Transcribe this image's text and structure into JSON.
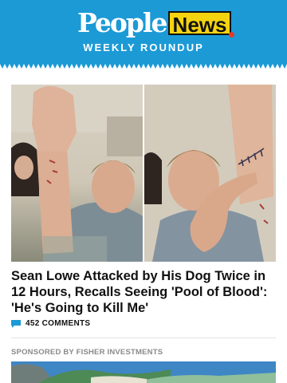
{
  "header": {
    "logo_people": "People",
    "logo_news": "News",
    "subtitle": "WEEKLY ROUNDUP",
    "background_color": "#1c9ad6"
  },
  "article": {
    "image_alt": "Sean Lowe showing bite wounds on his arm",
    "title": "Sean Lowe Attacked by His Dog Twice in 12 Hours, Recalls Seeing 'Pool of Blood': 'He's Going to Kill Me'",
    "comments_icon": "comment-icon",
    "comments_label": "452 COMMENTS"
  },
  "sponsored": {
    "label": "SPONSORED BY FISHER INVESTMENTS",
    "image_alt": "Coastal landscape"
  }
}
